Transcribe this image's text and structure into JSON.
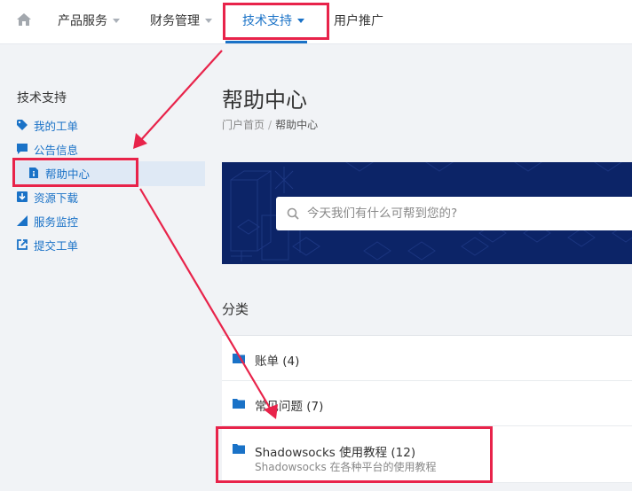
{
  "topnav": {
    "home_icon": "home-icon",
    "items": [
      {
        "label": "产品服务",
        "has_caret": true
      },
      {
        "label": "财务管理",
        "has_caret": true
      },
      {
        "label": "技术支持",
        "has_caret": true,
        "active": true
      },
      {
        "label": "用户推广",
        "has_caret": false
      }
    ]
  },
  "sidebar": {
    "title": "技术支持",
    "items": [
      {
        "label": "我的工单",
        "icon": "tag-icon"
      },
      {
        "label": "公告信息",
        "icon": "comment-icon"
      },
      {
        "label": "帮助中心",
        "icon": "info-file-icon",
        "active": true
      },
      {
        "label": "资源下载",
        "icon": "download-icon"
      },
      {
        "label": "服务监控",
        "icon": "signal-icon"
      },
      {
        "label": "提交工单",
        "icon": "external-link-icon"
      }
    ]
  },
  "main": {
    "title": "帮助中心",
    "breadcrumb": {
      "home": "门户首页",
      "separator": "/",
      "current": "帮助中心"
    },
    "search": {
      "placeholder": "今天我们有什么可帮到您的?"
    },
    "categories_title": "分类",
    "categories": [
      {
        "name": "账单 (4)",
        "icon": "folder-icon"
      },
      {
        "name": "常见问题 (7)",
        "icon": "folder-icon"
      },
      {
        "name": "Shadowsocks 使用教程 (12)",
        "description": "Shadowsocks 在各种平台的使用教程",
        "icon": "folder-icon"
      }
    ]
  },
  "colors": {
    "accent": "#1a72c7",
    "banner": "#0c2467",
    "annotation": "#e8234a"
  }
}
